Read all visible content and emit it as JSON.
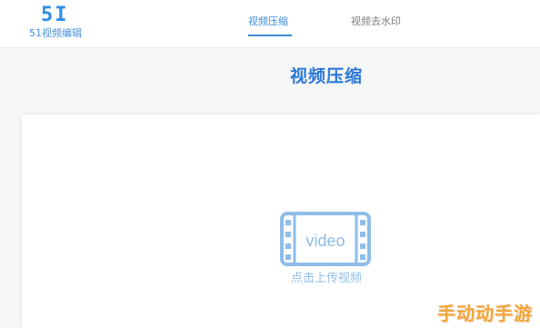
{
  "header": {
    "logo_mark": "5I",
    "logo_text": "51视频编辑",
    "tabs": [
      {
        "label": "视频压缩",
        "active": true
      },
      {
        "label": "视频去水印",
        "active": false
      }
    ]
  },
  "main": {
    "title": "视频压缩",
    "upload": {
      "icon_text": "video",
      "label": "点击上传视频"
    }
  },
  "watermark": "手动动手游",
  "colors": {
    "accent": "#3b8ad6",
    "icon": "#8fbdea",
    "watermark": "#f3a43a"
  },
  "icons": {
    "upload": "video-film-icon"
  }
}
